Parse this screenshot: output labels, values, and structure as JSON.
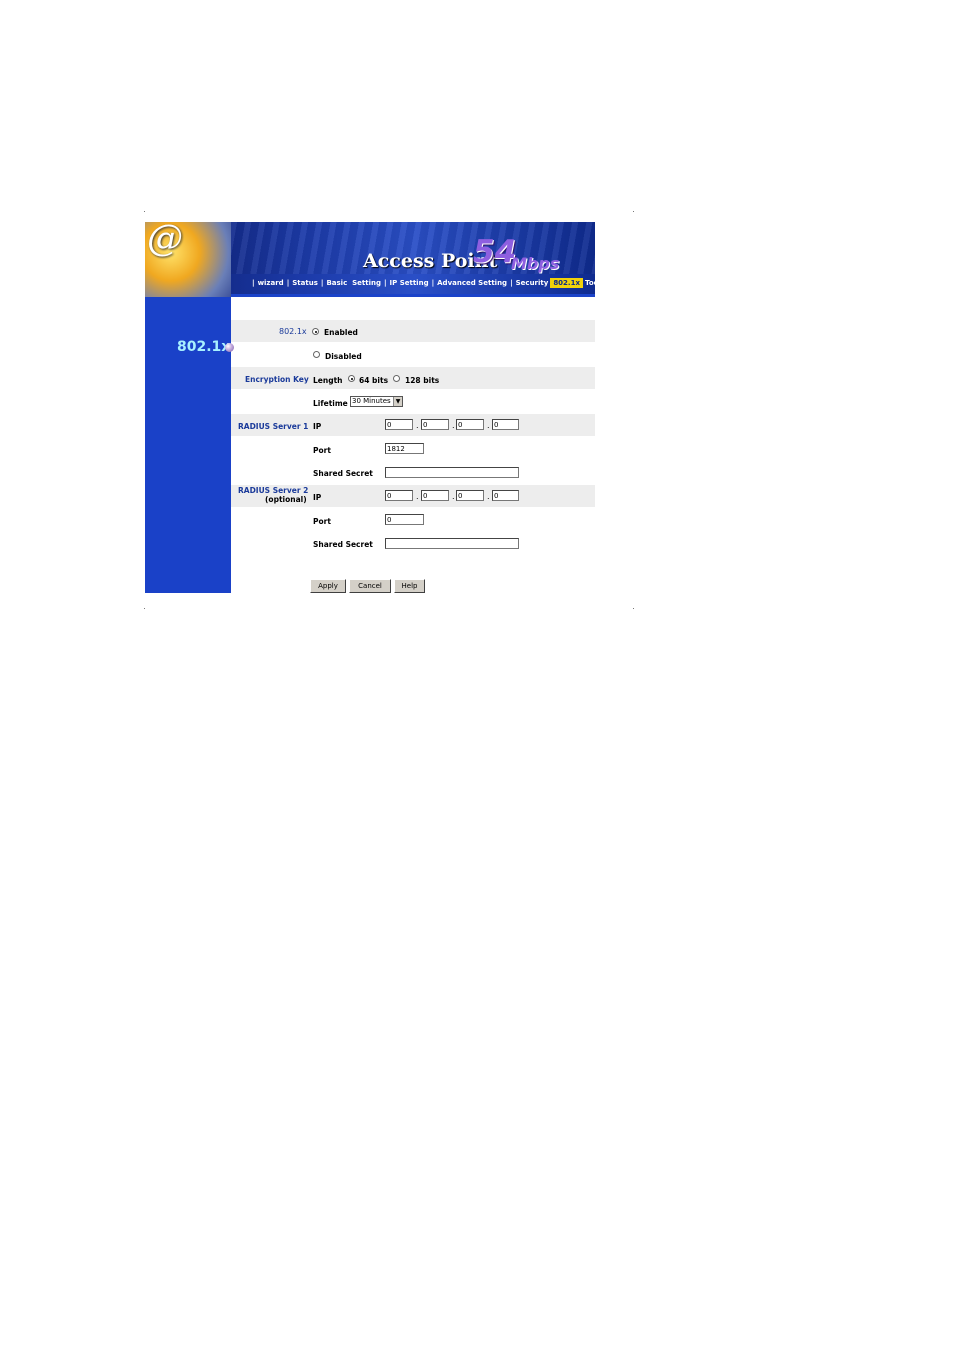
{
  "header": {
    "logo_at": "@",
    "title": "Access Point",
    "speed_number": "54",
    "speed_unit": "Mbps",
    "nav": [
      {
        "label": "wizard",
        "active": false
      },
      {
        "label": "Status",
        "active": false
      },
      {
        "label": "Basic  Setting",
        "active": false
      },
      {
        "label": "IP Setting",
        "active": false
      },
      {
        "label": "Advanced Setting",
        "active": false
      },
      {
        "label": "Security",
        "active": false
      },
      {
        "label": "802.1x",
        "active": true
      },
      {
        "label": "Tools",
        "active": false
      }
    ]
  },
  "sidebar": {
    "title": "802.1x"
  },
  "form": {
    "dot1x_label": "802.1x",
    "enabled_label": "Enabled",
    "disabled_label": "Disabled",
    "dot1x_selected": "Enabled",
    "enc_key_label": "Encryption Key",
    "length_label": "Length",
    "len_64_label": "64 bits",
    "len_128_label": "128 bits",
    "length_selected": "64 bits",
    "lifetime_label": "Lifetime",
    "lifetime_value": "30 Minutes",
    "radius1_label": "RADIUS Server 1",
    "radius2_label": "RADIUS Server 2",
    "radius2_sub": "(optional)",
    "ip_label": "IP",
    "port_label": "Port",
    "secret_label": "Shared Secret",
    "ip_sep": ".",
    "radius1_ip": [
      "0",
      "0",
      "0",
      "0"
    ],
    "radius1_port": "1812",
    "radius1_secret": "",
    "radius2_ip": [
      "0",
      "0",
      "0",
      "0"
    ],
    "radius2_port": "0",
    "radius2_secret": ""
  },
  "buttons": {
    "apply": "Apply",
    "cancel": "Cancel",
    "help": "Help"
  },
  "colors": {
    "sidebar": "#1a41c8",
    "active_tab": "#f2d20a",
    "label_blue": "#1a3a9a"
  }
}
